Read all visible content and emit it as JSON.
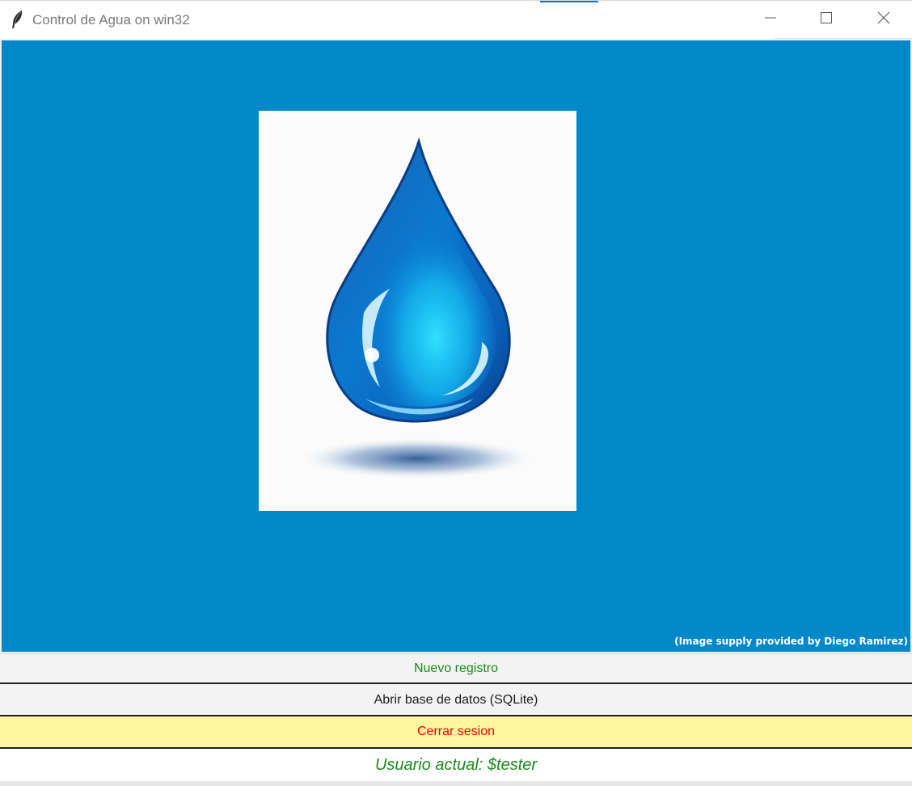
{
  "window": {
    "title": "Control de Agua on win32",
    "app_icon": "feather-icon",
    "controls": {
      "minimize_icon": "minimize-icon",
      "maximize_icon": "maximize-icon",
      "close_icon": "close-icon"
    }
  },
  "main": {
    "image_icon": "water-drop-icon",
    "credit": "(Image supply provided by Diego Ramirez)"
  },
  "buttons": {
    "nuevo_registro": "Nuevo registro",
    "abrir_base": "Abrir base de datos (SQLite)",
    "cerrar_sesion": "Cerrar sesion"
  },
  "status": {
    "usuario_actual": "Usuario actual: $tester"
  },
  "colors": {
    "panel_blue": "#0088c8",
    "nuevo_text": "#1a8a1a",
    "abrir_text": "#1a1a1a",
    "cerrar_text": "#ff0000",
    "cerrar_bg": "#fff7a0",
    "user_text": "#1a8a1a",
    "title_accent": "#0078d7"
  }
}
